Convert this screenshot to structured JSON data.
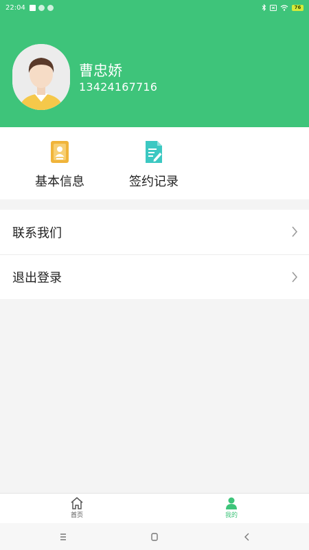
{
  "status_bar": {
    "time": "22:04",
    "battery": "76"
  },
  "profile": {
    "name": "曹忠娇",
    "phone": "13424167716"
  },
  "quick_actions": [
    {
      "label": "基本信息",
      "icon": "id-card-icon"
    },
    {
      "label": "签约记录",
      "icon": "document-edit-icon"
    }
  ],
  "menu": [
    {
      "label": "联系我们"
    },
    {
      "label": "退出登录"
    }
  ],
  "tabs": [
    {
      "label": "首页",
      "icon": "home-icon",
      "active": false
    },
    {
      "label": "我的",
      "icon": "person-icon",
      "active": true
    }
  ],
  "colors": {
    "primary_green": "#3ec47a",
    "badge_yellow": "#f0b43a",
    "doc_teal": "#3cc8c2"
  }
}
